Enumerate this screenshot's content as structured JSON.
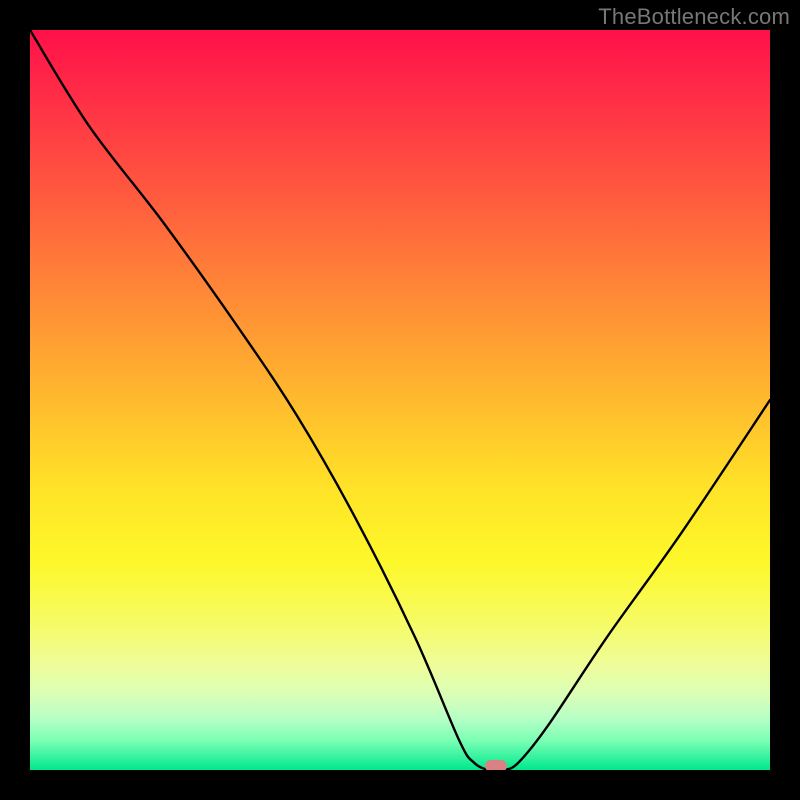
{
  "watermark": "TheBottleneck.com",
  "chart_data": {
    "type": "line",
    "title": "",
    "xlabel": "",
    "ylabel": "",
    "xlim": [
      0,
      100
    ],
    "ylim": [
      0,
      100
    ],
    "grid": false,
    "legend": false,
    "series": [
      {
        "name": "bottleneck-curve",
        "x": [
          0,
          8,
          18,
          28,
          36,
          44,
          52,
          58,
          60,
          62,
          64,
          66,
          70,
          78,
          88,
          100
        ],
        "y": [
          100,
          87,
          74,
          60,
          48,
          34,
          18,
          4,
          1,
          0,
          0,
          1,
          6,
          18,
          32,
          50
        ]
      }
    ],
    "marker": {
      "x": 63,
      "y": 0.5,
      "color": "#da8183"
    },
    "background_gradient": {
      "top": "#ff1049",
      "mid": "#ffe327",
      "bottom": "#00e88e"
    }
  }
}
